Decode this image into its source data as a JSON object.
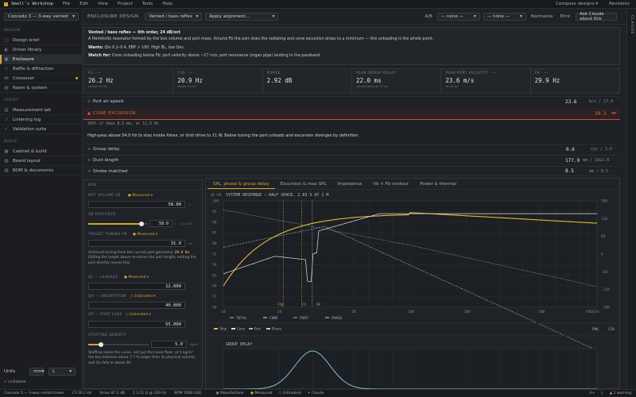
{
  "menubar": {
    "app": "Small's Workshop",
    "items": [
      "File",
      "Edit",
      "View",
      "Project",
      "Tools",
      "Help"
    ],
    "compose": "Compose designs",
    "revisions": "Revisions"
  },
  "left": {
    "project": "Coocado 3 — 3-way vented",
    "sections": [
      {
        "title": "DESIGN",
        "items": [
          {
            "icon": "□",
            "label": "Design brief"
          },
          {
            "icon": "◐",
            "label": "Driver library"
          },
          {
            "icon": "▣",
            "label": "Enclosure",
            "active": true
          },
          {
            "icon": "◇",
            "label": "Baffle & diffraction"
          },
          {
            "icon": "⋈",
            "label": "Crossover",
            "dot": true
          },
          {
            "icon": "▤",
            "label": "Room & system"
          }
        ]
      },
      {
        "title": "VERIFY",
        "items": [
          {
            "icon": "▥",
            "label": "Measurement lab"
          },
          {
            "icon": "♪",
            "label": "Listening log"
          },
          {
            "icon": "✓",
            "label": "Validation suite"
          }
        ]
      },
      {
        "title": "BUILD",
        "items": [
          {
            "icon": "▦",
            "label": "Cabinet & build"
          },
          {
            "icon": "▧",
            "label": "Board layout"
          },
          {
            "icon": "▨",
            "label": "BOM & documents"
          }
        ]
      }
    ],
    "units_label": "Units",
    "unit1": "mm",
    "unit2": "L",
    "collapse": "« collapse"
  },
  "toolbar": {
    "section": "ENCLOSURE DESIGN",
    "type": "Vented / bass reflex",
    "align": "Apply alignment...",
    "ab": "A/B",
    "none1": "— none —",
    "none2": "— none —",
    "normalize": "Normalize",
    "print": "Print",
    "ask": "Ask Claude about this"
  },
  "desc": {
    "title": "Vented / bass reflex — 4th order, 24 dB/oct",
    "body": "A Helmholtz resonator formed by the box volume and port mass. Around Fb the port does the radiating and cone excursion drops to a minimum — this unloading is the whole point.",
    "wants_label": "Wants:",
    "wants": "Qts 0.2–0.4, EBP > 100. High BL, low Qes.",
    "watch_label": "Watch for:",
    "watch": "Cone unloading below Fb; port velocity above ~17 m/s; port resonance (organ pipe) landing in the passband."
  },
  "metrics": [
    {
      "label": "F3 · —",
      "value": "26.2 Hz",
      "sub": "target 32 Hz"
    },
    {
      "label": "F10 · —",
      "value": "20.9 Hz",
      "sub": "target 24 Hz"
    },
    {
      "label": "RIPPLE",
      "value": "2.92 dB",
      "sub": ""
    },
    {
      "label": "PEAK GROUP DELAY",
      "value": "22.0 ms",
      "sub": "comfortable at 77 Hz"
    },
    {
      "label": "PEAK PORT VELOCITY · —",
      "value": "23.6 m/s",
      "sub": "at 42 Hz"
    },
    {
      "label": "FB · —",
      "value": "29.9 Hz",
      "sub": ""
    }
  ],
  "checks": {
    "port_air": {
      "label": "Port air speed",
      "value": "23.6",
      "unit": "m/s / 17.0"
    },
    "cone": {
      "label": "CONE EXCURSION",
      "value": "30.3",
      "unit": "mm"
    },
    "cone_sub": "302% of Xmax 8.5 mm, at 12.0 Hz",
    "hp": "High-pass above 54.0 Hz to stay inside Xmax, or limit drive to 11 W. Below tuning the port unloads and excursion diverges by definition.",
    "gd": {
      "label": "Group delay",
      "value": "0.6",
      "unit": "cyc / 1.5"
    },
    "duct": {
      "label": "Duct length",
      "value": "177.9",
      "unit": "mm / 1022.0"
    },
    "stroke": {
      "label": "Stroke matched",
      "value": "8.5",
      "unit": "mm / 8.5"
    }
  },
  "box": {
    "title": "BOX",
    "net_label": "NET VOLUME VB",
    "net_badge": "● Measured",
    "net_value": "58.00",
    "net_unit": "L",
    "vb_label": "VB EXPLORER",
    "vb_value": "58.0",
    "vb_unit": "L",
    "vb_extra": "(2× 0.6)",
    "fb_label": "TARGET TUNING FB",
    "fb_badge": "● Measured",
    "fb_value": "31.0",
    "fb_unit": "Hz",
    "note_a": "Achieved tuning from the current port geometry:",
    "note_freq": "29.9 Hz",
    "note_b": "Editing the target above re-solves the port length; editing the port directly moves this.",
    "ql_label": "QL — LEAKAGE",
    "ql_badge": "● Measured",
    "ql_value": "12.000",
    "qa_label": "QA — ABSORPTION",
    "qa_badge": "○ Estimated",
    "qa_value": "40.000",
    "qp_label": "QP — PORT LOSS",
    "qp_badge": "○ Estimated",
    "qp_value": "55.000",
    "stuff_label": "STUFFING DENSITY",
    "stuff_value": "5.0",
    "stuff_unit": "kg/m³",
    "stuff_note": "Stuffing raises the curve, not just the noise floor: at 5 kg/m³ the box behaves about 7.7 % larger than its physical volume, and Qa falls to about 40."
  },
  "tabs": [
    "SPL, phase & group delay",
    "Excursion & max SPL",
    "Impedance",
    "Vb × Fb contour",
    "Power & thermal"
  ],
  "chart": {
    "title": "SYSTEM RESPONSE — HALF SPACE, 2.83 V AT 1 M",
    "spl_label": "dB SPL",
    "yleft": [
      "100",
      "95",
      "90",
      "85",
      "80",
      "75",
      "70",
      "65",
      "60",
      "55",
      "50"
    ],
    "yright": [
      "180",
      "120",
      "60",
      "0",
      "-60",
      "-120",
      "-180"
    ],
    "xticks": [
      "10",
      "20",
      "50",
      "100",
      "200",
      "500",
      "1k"
    ],
    "xunit": "FREQ",
    "f3": "F3",
    "f10": "F10",
    "fb": "FB",
    "legend": [
      {
        "label": "TOTAL",
        "sub": "",
        "color": "#e8b93a"
      },
      {
        "label": "CONE",
        "sub": "dB SPL",
        "color": "#dfe2e6"
      },
      {
        "label": "PORT",
        "sub": "dB SPL",
        "color": "#a9adb4"
      },
      {
        "label": "PHASE",
        "sub": "dB SPL",
        "color": "#c7c9cd"
      }
    ],
    "toggles": [
      "Total",
      "Cone",
      "Port",
      "Phase"
    ],
    "png": "PNG",
    "csv": "CSV",
    "gd_title": "GROUP DELAY"
  },
  "status": {
    "project": "Coocado 3 — 3-way vented tower",
    "f3": "F3 26.2 Hz",
    "xmax": "Xmax 87.2 dB",
    "fb": "Σ 3.51 Ω @ 229 Hz",
    "bom": "BOM 1980 USD",
    "legend": [
      "Manufacturer",
      "Measured",
      "Estimated",
      "Claude"
    ],
    "right": [
      "A+",
      "L",
      "1 warning"
    ]
  },
  "right": {
    "label": "CLAUDE"
  }
}
